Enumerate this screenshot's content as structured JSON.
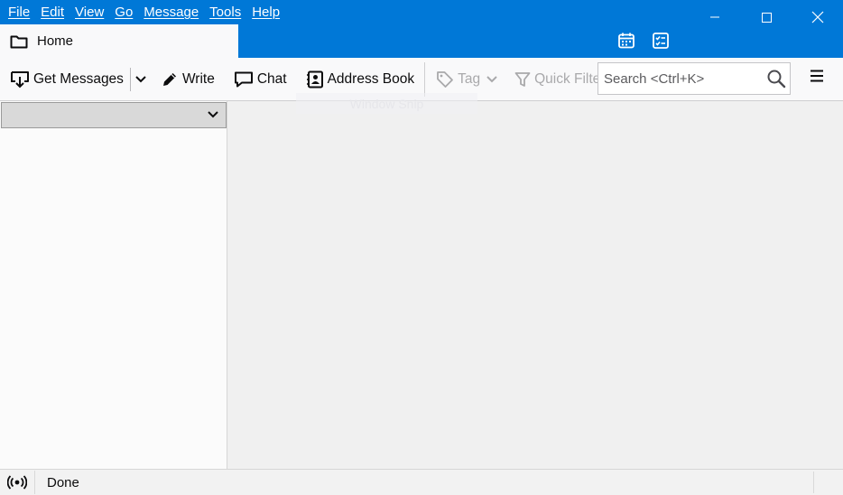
{
  "menubar": {
    "items": [
      "File",
      "Edit",
      "View",
      "Go",
      "Message",
      "Tools",
      "Help"
    ]
  },
  "tabs": {
    "home_label": "Home"
  },
  "toolbar": {
    "get_messages": "Get Messages",
    "write": "Write",
    "chat": "Chat",
    "address_book": "Address Book",
    "tag": "Tag",
    "quick_filter": "Quick Filter",
    "search_placeholder": "Search <Ctrl+K>"
  },
  "overlay": {
    "ghost_tooltip": "Window Snip"
  },
  "statusbar": {
    "text": "Done"
  },
  "colors": {
    "titlebar": "#0078d7",
    "toolbar_bg": "#f9f9fa",
    "main_bg": "#f0f0f0",
    "folder_selector": "#d9d9d9",
    "disabled_text": "#a9a9ab"
  },
  "icons": {
    "tab": "folder-icon",
    "get_messages": "download-icon",
    "write": "pencil-icon",
    "chat": "chat-bubble-icon",
    "address_book": "address-book-icon",
    "tag": "tag-icon",
    "quick_filter": "funnel-icon",
    "search": "magnifier-icon",
    "app_menu": "hamburger-icon",
    "calendar": "calendar-icon",
    "tasks": "tasks-icon",
    "status": "online-status-icon"
  }
}
